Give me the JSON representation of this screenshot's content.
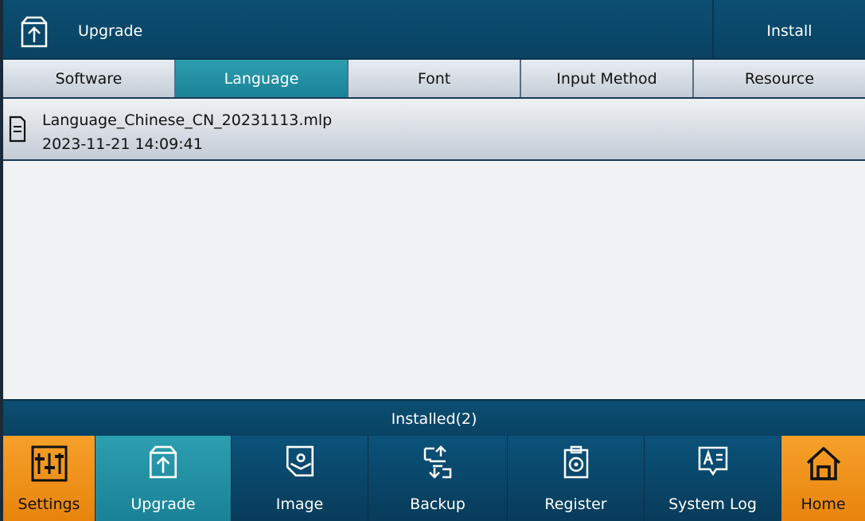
{
  "header": {
    "title": "Upgrade",
    "install_label": "Install"
  },
  "tabs": [
    {
      "label": "Software",
      "active": false
    },
    {
      "label": "Language",
      "active": true
    },
    {
      "label": "Font",
      "active": false
    },
    {
      "label": "Input Method",
      "active": false
    },
    {
      "label": "Resource",
      "active": false
    }
  ],
  "files": [
    {
      "name": "Language_Chinese_CN_20231113.mlp",
      "date": "2023-11-21 14:09:41",
      "icon": "document-icon"
    }
  ],
  "status": {
    "text": "Installed(2)"
  },
  "nav": [
    {
      "label": "Settings",
      "icon": "settings-sliders-icon",
      "style": "orange"
    },
    {
      "label": "Upgrade",
      "icon": "upgrade-icon",
      "style": "active"
    },
    {
      "label": "Image",
      "icon": "image-icon",
      "style": "normal"
    },
    {
      "label": "Backup",
      "icon": "backup-icon",
      "style": "normal"
    },
    {
      "label": "Register",
      "icon": "register-icon",
      "style": "normal"
    },
    {
      "label": "System Log",
      "icon": "system-log-icon",
      "style": "normal"
    },
    {
      "label": "Home",
      "icon": "home-icon",
      "style": "orange"
    }
  ],
  "colors": {
    "header_bg": "#0a4263",
    "active_tab": "#2c9fb0",
    "orange": "#f6a02a",
    "content_bg": "#f0f2f4"
  }
}
